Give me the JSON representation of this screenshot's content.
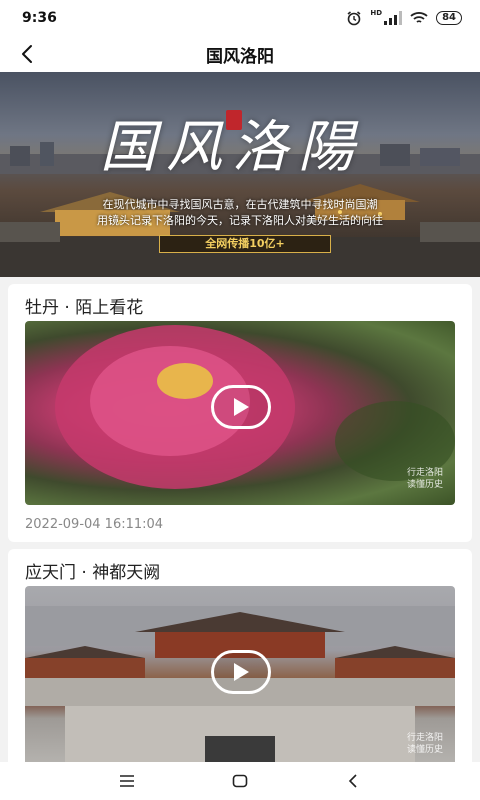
{
  "status": {
    "time": "9:36",
    "battery": "84",
    "network_label": "HD"
  },
  "header": {
    "title": "国风洛阳"
  },
  "banner": {
    "title_art": "国风洛陽",
    "desc_line1": "在现代城市中寻找国风古意，在古代建筑中寻找时尚国潮",
    "desc_line2": "用镜头记录下洛阳的今天，记录下洛阳人对美好生活的向往",
    "badge": "全网传播10亿+"
  },
  "videos": [
    {
      "title": "牡丹 · 陌上看花",
      "date": "2022-09-04 16:11:04",
      "watermark_line1": "行走洛阳",
      "watermark_line2": "读懂历史"
    },
    {
      "title": "应天门 · 神都天阙",
      "watermark_line1": "行走洛阳",
      "watermark_line2": "读懂历史"
    }
  ],
  "icons": {
    "back": "chevron-left-icon",
    "play": "play-icon",
    "menu": "menu-icon",
    "home": "home-icon",
    "system_back": "back-triangle-icon"
  }
}
